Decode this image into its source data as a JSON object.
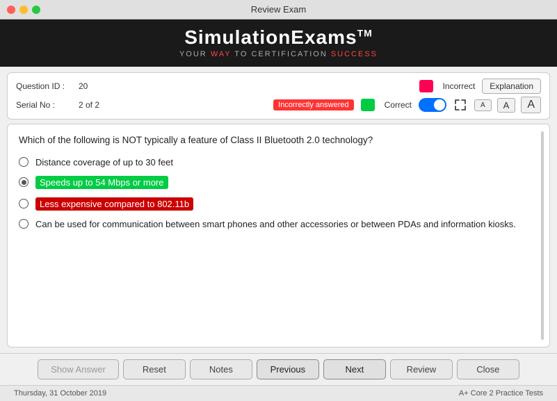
{
  "titleBar": {
    "title": "Review Exam"
  },
  "header": {
    "brandTitle": "SimulationExams",
    "taglineParts": [
      "YOUR ",
      "WAY",
      " TO CERTIFICATION ",
      "SUCCESS"
    ],
    "taglineHighlight1": "WAY",
    "taglineHighlight2": "SUCCESS"
  },
  "infoPanel": {
    "questionIdLabel": "Question ID :",
    "questionIdValue": "20",
    "serialNoLabel": "Serial No :",
    "serialNoValue": "2 of 2",
    "incorrectLabel": "Incorrect",
    "correctLabel": "Correct",
    "incorrectlyAnsweredBadge": "Incorrectly answered",
    "explanationBtnLabel": "Explanation",
    "fontBtns": [
      "A",
      "A",
      "A"
    ]
  },
  "question": {
    "text": "Which of the following is NOT typically a feature of Class II Bluetooth 2.0 technology?",
    "options": [
      {
        "id": "opt1",
        "text": "Distance coverage of up to 30 feet",
        "state": "normal",
        "selected": false
      },
      {
        "id": "opt2",
        "text": "Speeds up to 54 Mbps or more",
        "state": "correct",
        "selected": true
      },
      {
        "id": "opt3",
        "text": "Less expensive compared to 802.11b",
        "state": "wrong",
        "selected": false
      },
      {
        "id": "opt4",
        "text": "Can be used for communication between smart phones and other accessories or between PDAs and information kiosks.",
        "state": "normal",
        "selected": false
      }
    ]
  },
  "toolbar": {
    "showAnswerLabel": "Show Answer",
    "resetLabel": "Reset",
    "notesLabel": "Notes",
    "previousLabel": "Previous",
    "nextLabel": "Next",
    "reviewLabel": "Review",
    "closeLabel": "Close"
  },
  "footer": {
    "date": "Thursday, 31 October 2019",
    "product": "A+ Core 2 Practice Tests"
  }
}
